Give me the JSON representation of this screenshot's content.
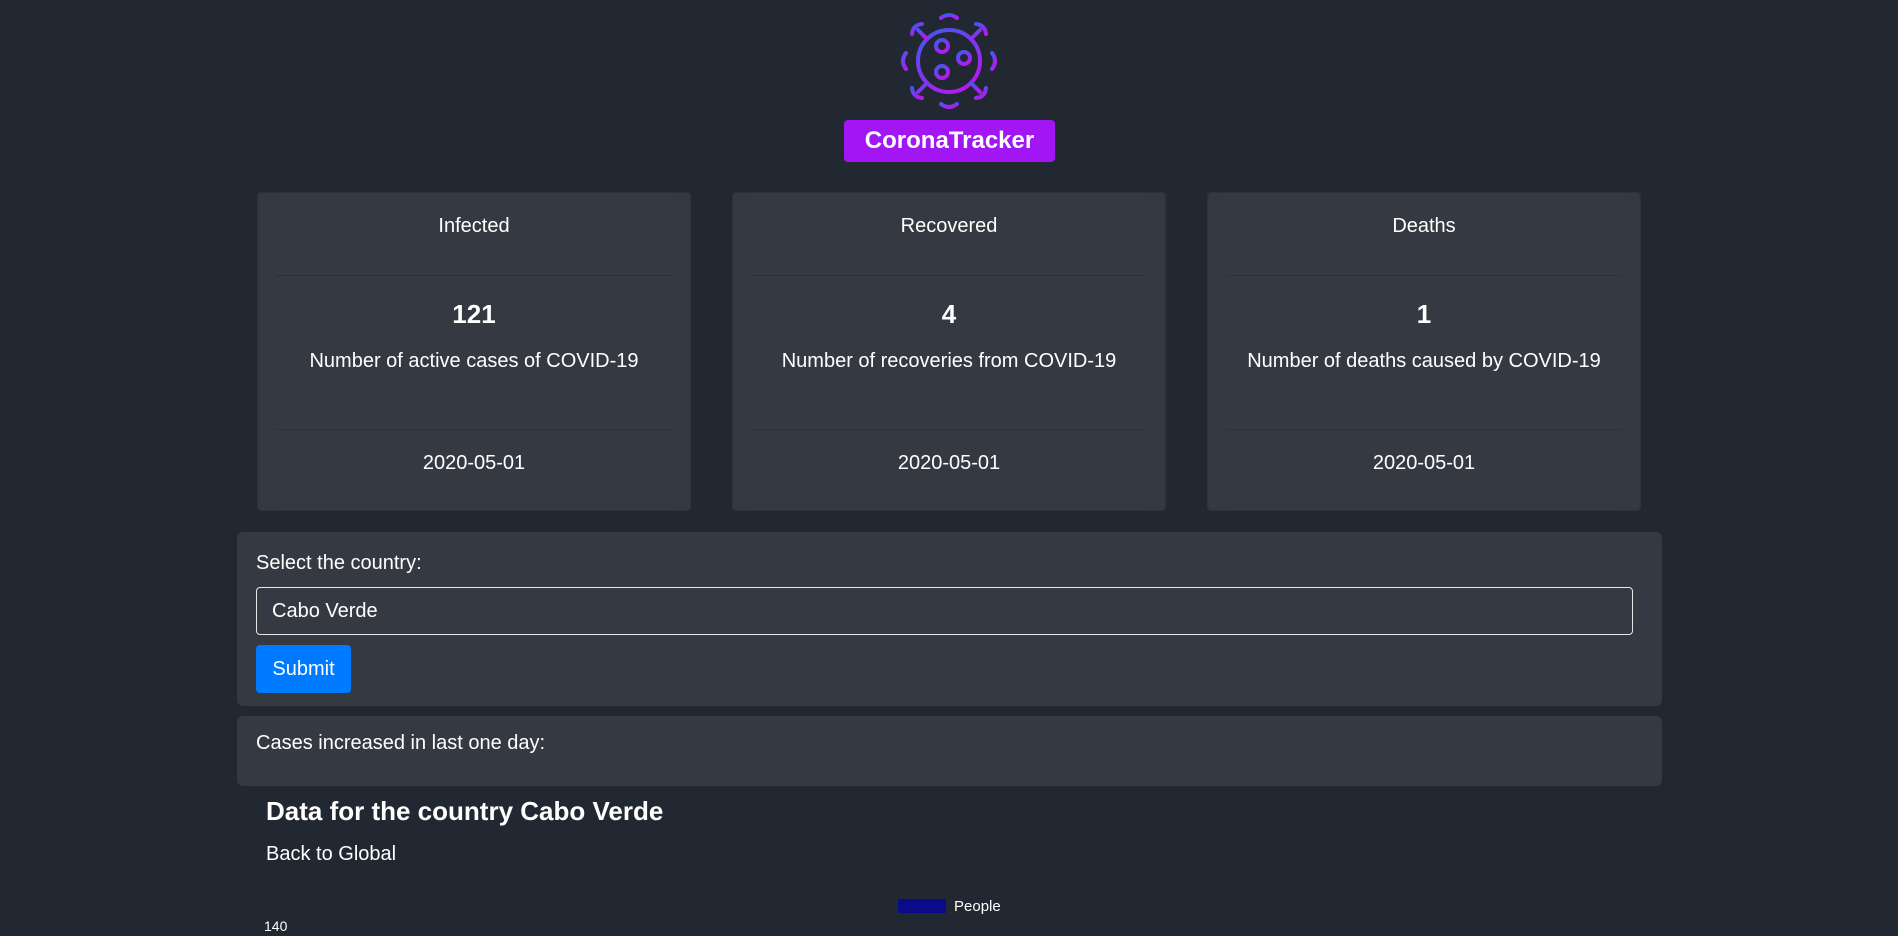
{
  "app": {
    "brand_label": "CoronaTracker"
  },
  "cards": [
    {
      "title": "Infected",
      "value": "121",
      "description": "Number of active cases of COVID-19",
      "date": "2020-05-01"
    },
    {
      "title": "Recovered",
      "value": "4",
      "description": "Number of recoveries from COVID-19",
      "date": "2020-05-01"
    },
    {
      "title": "Deaths",
      "value": "1",
      "description": "Number of deaths caused by COVID-19",
      "date": "2020-05-01"
    }
  ],
  "form": {
    "label": "Select the country:",
    "country_value": "Cabo Verde",
    "submit_label": "Submit"
  },
  "increase": {
    "label": "Cases increased in last one day:"
  },
  "country_section": {
    "title": "Data for the country Cabo Verde",
    "back_label": "Back to Global"
  },
  "chart_data": {
    "type": "bar",
    "series": [
      {
        "name": "People",
        "color": "#0b0b8a"
      }
    ],
    "y_ticks": [
      "140"
    ]
  },
  "colors": {
    "background": "#222831",
    "panel": "#353941",
    "brand": "#a116f2",
    "primary": "#007bff",
    "logo_gradient_start": "#3d5af1",
    "logo_gradient_end": "#a116f2"
  }
}
